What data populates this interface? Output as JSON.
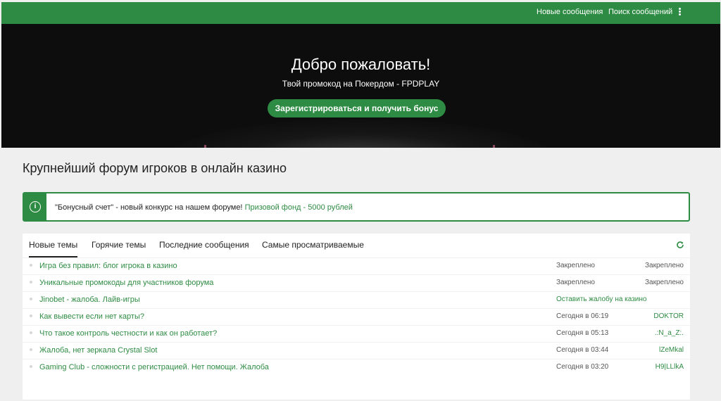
{
  "colors": {
    "accent": "#2e8b43",
    "hero_bg": "#0d0d0d",
    "page_bg": "#efefef"
  },
  "topbar": {
    "new_messages": "Новые сообщения",
    "search_messages": "Поиск сообщений",
    "more_icon": "vertical-dots-icon"
  },
  "hero": {
    "title": "Добро пожаловать!",
    "subtitle": "Твой промокод на Покердом - FPDPLAY",
    "button": "Зарегистрироваться и получить бонус"
  },
  "page_title": "Крупнейший форум игроков в онлайн казино",
  "notice": {
    "icon": "info-icon",
    "text": "\"Бонусный счет\" - новый конкурс на нашем форуме!",
    "link": "Призовой фонд - 5000 рублей"
  },
  "tabs": [
    "Новые темы",
    "Горячие темы",
    "Последние сообщения",
    "Самые просматриваемые"
  ],
  "active_tab": "Новые темы",
  "refresh_icon": "refresh-icon",
  "topics": [
    {
      "title": "Игра без правил: блог игрока в казино",
      "time": "Закреплено",
      "author": "Закреплено"
    },
    {
      "title": "Уникальные промокоды для участников форума",
      "time": "Закреплено",
      "author": "Закреплено"
    },
    {
      "title": "Jinobet - жалоба. Лайв-игры",
      "time": "Оставить жалобу на казино",
      "author": ""
    },
    {
      "title": "Как вывести если нет карты?",
      "time": "Сегодня в 06:19",
      "author": "DOKTOR"
    },
    {
      "title": "Что такое контроль честности и как он работает?",
      "time": "Сегодня в 05:13",
      "author": ".:N_a_Z:."
    },
    {
      "title": "Жалоба, нет зеркала Crystal Slot",
      "time": "Сегодня в 03:44",
      "author": "lZeMkal"
    },
    {
      "title": "Gaming Club - сложности с регистрацией. Нет помощи. Жалоба",
      "time": "Сегодня в 03:20",
      "author": "H9|LLlkA"
    }
  ]
}
